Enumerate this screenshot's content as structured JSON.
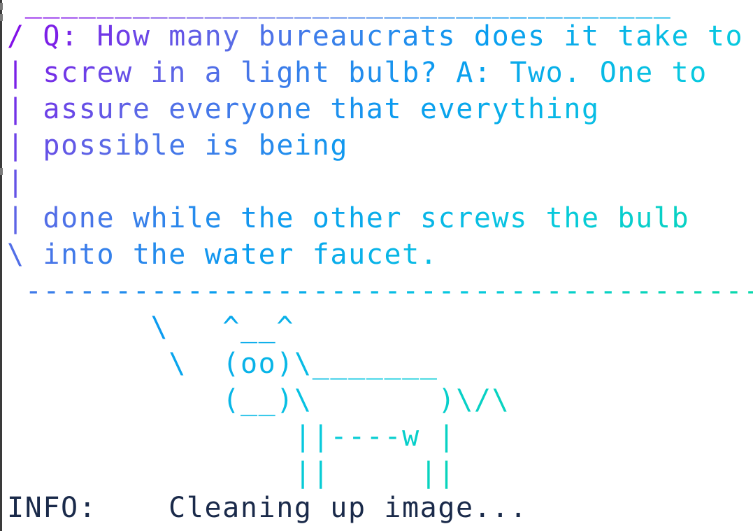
{
  "terminal": {
    "lines": [
      " ____________________________________",
      "/ Q: How many bureaucrats does it take to \\",
      "| screw in a light bulb? A: Two. One to     |",
      "| assure everyone that everything           |",
      "| possible is being                         |",
      "|                                           |",
      "| done while the other screws the bulb      |",
      "\\ into the water faucet.                    /",
      " ------------------------------------------",
      "        \\   ^__^",
      "         \\  (oo)\\_______",
      "            (__)\\       )\\/\\",
      "                ||----w |",
      "                ||     ||"
    ],
    "status_line": "INFO:    Cleaning up image...",
    "gradient_colors": [
      "#8a00e8",
      "#5a6ae6",
      "#0a9cf0",
      "#07c8e0",
      "#08d8b0",
      "#10d8a0"
    ],
    "status_color": "#1a2a4a"
  }
}
